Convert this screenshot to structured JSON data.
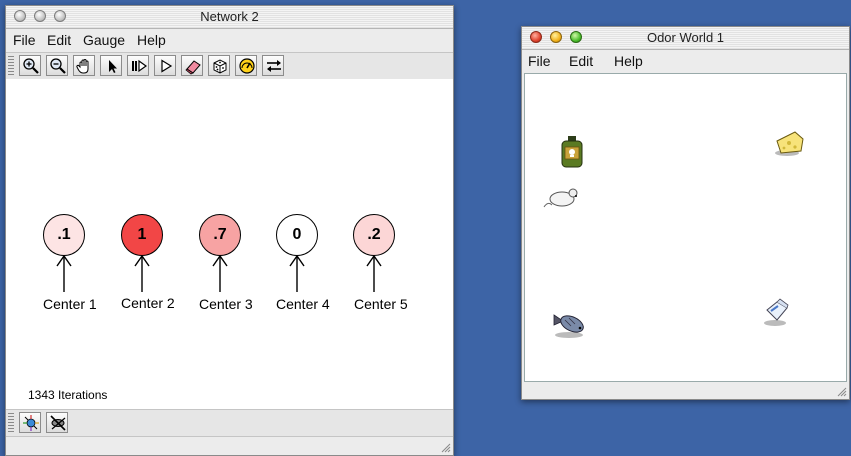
{
  "network_window": {
    "title": "Network 2",
    "menus": [
      "File",
      "Edit",
      "Gauge",
      "Help"
    ],
    "toolbar_icons": [
      "zoom-in-icon",
      "zoom-out-icon",
      "hand-pan-icon",
      "arrow-select-icon",
      "step-icon",
      "play-icon",
      "eraser-icon",
      "random-dice-icon",
      "gauge-icon",
      "swap-arrows-icon"
    ],
    "neurons": [
      {
        "value": ".1",
        "label": "Center 1",
        "color": "#fde4e4"
      },
      {
        "value": "1",
        "label": "Center 2",
        "color": "#f24646"
      },
      {
        "value": ".7",
        "label": "Center 3",
        "color": "#f7a3a3"
      },
      {
        "value": "0",
        "label": "Center 4",
        "color": "#ffffff"
      },
      {
        "value": ".2",
        "label": "Center 5",
        "color": "#fcd6d6"
      }
    ],
    "status": "1343 Iterations",
    "bottom_icons": [
      "network-node-icon",
      "hide-node-icon"
    ]
  },
  "odor_window": {
    "title": "Odor World 1",
    "menus": [
      "File",
      "Edit",
      "Help"
    ],
    "objects": [
      "poison-bottle-icon",
      "cheese-icon",
      "mouse-icon",
      "fish-icon",
      "milk-carton-icon"
    ]
  }
}
